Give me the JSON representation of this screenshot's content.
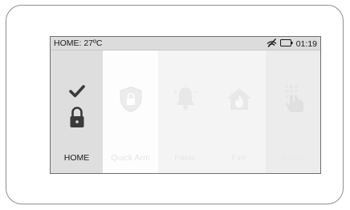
{
  "status_bar": {
    "title": "HOME: 27ºC",
    "time": "01:19",
    "icons": [
      "signal-off-icon",
      "battery-icon"
    ]
  },
  "tiles": [
    {
      "label": "HOME",
      "icon": "lock-check-icon",
      "active": true
    },
    {
      "label": "Quick Arm",
      "icon": "shield-lock-icon",
      "active": false
    },
    {
      "label": "Panic",
      "icon": "bell-icon",
      "active": false
    },
    {
      "label": "Fire",
      "icon": "house-fire-icon",
      "active": false
    },
    {
      "label": "Login",
      "icon": "keypad-touch-icon",
      "active": false
    }
  ],
  "colors": {
    "status_bar_bg": "#dcdcdc",
    "active_tile_bg": "#dedede",
    "active_icon": "#3a3a3a",
    "inactive_icon": "#e8e8e8"
  }
}
